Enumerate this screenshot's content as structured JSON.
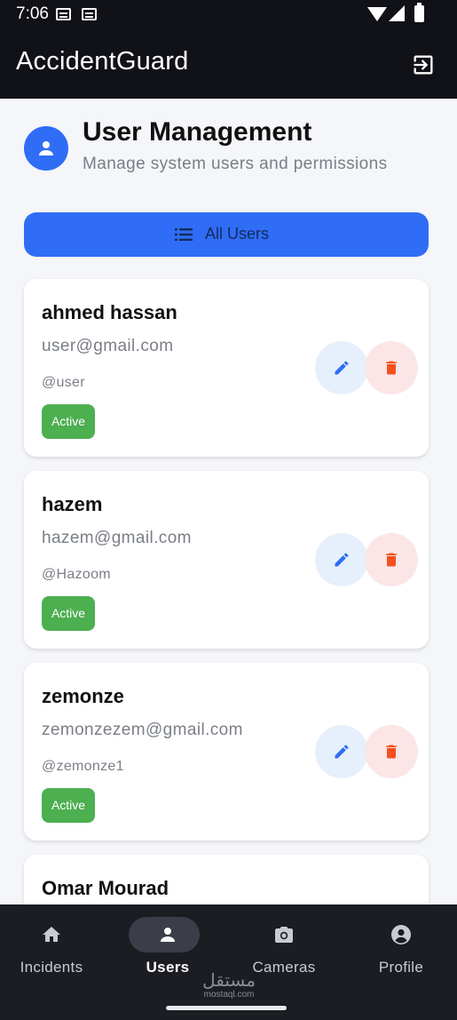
{
  "status_bar": {
    "time": "7:06"
  },
  "app_bar": {
    "title": "AccidentGuard",
    "logout_icon": "logout-icon"
  },
  "header": {
    "title": "User Management",
    "subtitle": "Manage system users and permissions",
    "avatar_icon": "person-icon"
  },
  "filter": {
    "label": "All Users",
    "icon": "list-icon"
  },
  "users": [
    {
      "name": "ahmed hassan",
      "email": "user@gmail.com",
      "handle": "@user",
      "status": "Active"
    },
    {
      "name": "hazem",
      "email": "hazem@gmail.com",
      "handle": "@Hazoom",
      "status": "Active"
    },
    {
      "name": "zemonze",
      "email": "zemonzezem@gmail.com",
      "handle": "@zemonze1",
      "status": "Active"
    },
    {
      "name": "Omar Mourad"
    }
  ],
  "nav": {
    "items": [
      {
        "label": "Incidents",
        "icon": "home-icon"
      },
      {
        "label": "Users",
        "icon": "person-icon",
        "active": true
      },
      {
        "label": "Cameras",
        "icon": "camera-icon"
      },
      {
        "label": "Profile",
        "icon": "account-circle-icon"
      }
    ]
  },
  "watermark": {
    "arabic": "مستقل",
    "site": "mostaql.com"
  },
  "colors": {
    "primary": "#2f6df6",
    "active_badge": "#4caf50",
    "delete": "#f4511e",
    "appbar": "#111217",
    "nav_bg": "#1b1d23"
  }
}
